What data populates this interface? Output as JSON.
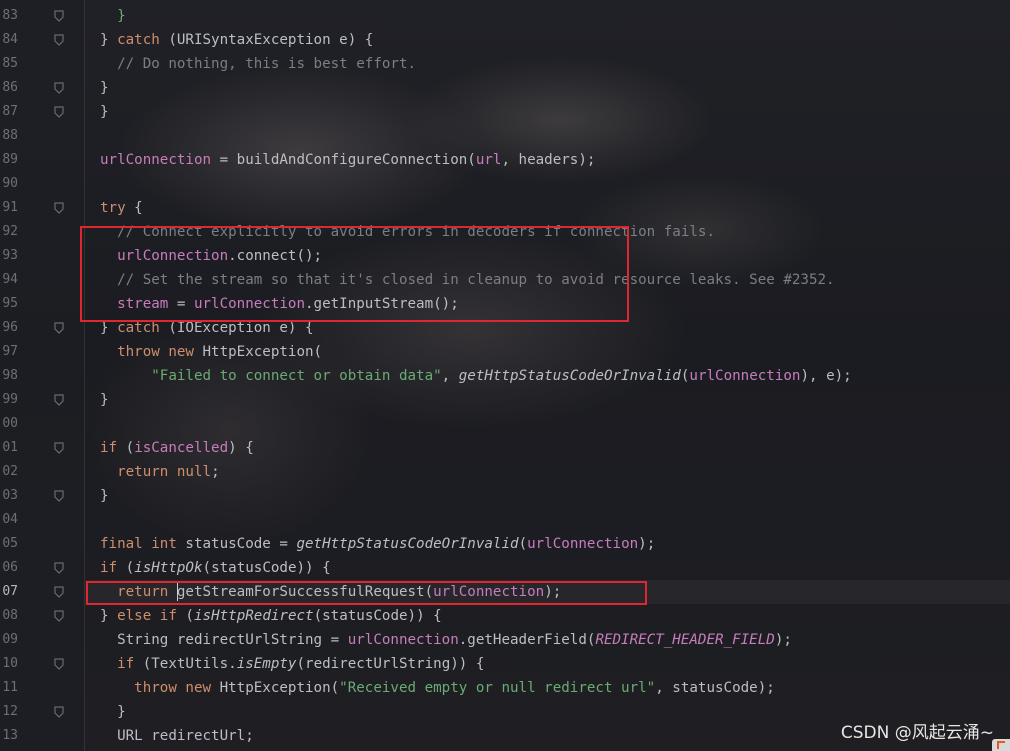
{
  "editor": {
    "gutter": {
      "line_numbers": [
        "83",
        "84",
        "85",
        "86",
        "87",
        "88",
        "89",
        "90",
        "91",
        "92",
        "93",
        "94",
        "95",
        "96",
        "97",
        "98",
        "99",
        "00",
        "01",
        "02",
        "03",
        "04",
        "05",
        "06",
        "07",
        "08",
        "09",
        "10",
        "11",
        "12",
        "13"
      ],
      "current_line": "07"
    },
    "lines": [
      [
        "  ",
        {
          "t": "}",
          "c": "str"
        }
      ],
      [
        {
          "t": "} "
        },
        {
          "t": "catch",
          "c": "kw"
        },
        {
          "t": " (URISyntaxException e) {"
        }
      ],
      [
        "  ",
        {
          "t": "// Do nothing, this is best effort.",
          "c": "cm"
        }
      ],
      [
        {
          "t": "}"
        }
      ],
      [
        "}"
      ],
      [
        ""
      ],
      [
        {
          "t": "urlConnection",
          "c": "fld"
        },
        {
          "t": " = buildAndConfigureConnection("
        },
        {
          "t": "url",
          "c": "fld"
        },
        {
          "t": ", headers);"
        }
      ],
      [
        ""
      ],
      [
        {
          "t": "try",
          "c": "kw"
        },
        {
          "t": " {"
        }
      ],
      [
        "  ",
        {
          "t": "// Connect explicitly to avoid errors in decoders if connection fails.",
          "c": "cm"
        }
      ],
      [
        "  ",
        {
          "t": "urlConnection",
          "c": "fld"
        },
        {
          "t": ".connect();"
        }
      ],
      [
        "  ",
        {
          "t": "// Set the stream so that it's closed in cleanup to avoid resource leaks. See #2352.",
          "c": "cm"
        }
      ],
      [
        "  ",
        {
          "t": "stream",
          "c": "fld"
        },
        {
          "t": " = "
        },
        {
          "t": "urlConnection",
          "c": "fld"
        },
        {
          "t": ".getInputStream();"
        }
      ],
      [
        {
          "t": "} "
        },
        {
          "t": "catch",
          "c": "kw"
        },
        {
          "t": " (IOException e) {"
        }
      ],
      [
        "  ",
        {
          "t": "throw new",
          "c": "kw"
        },
        {
          "t": " HttpException("
        }
      ],
      [
        "      ",
        {
          "t": "\"Failed to connect or obtain data\"",
          "c": "str"
        },
        {
          "t": ", "
        },
        {
          "t": "getHttpStatusCodeOrInvalid",
          "c": "ita"
        },
        {
          "t": "("
        },
        {
          "t": "urlConnection",
          "c": "fld"
        },
        {
          "t": "), e);"
        }
      ],
      [
        "}"
      ],
      [
        ""
      ],
      [
        {
          "t": "if",
          "c": "kw"
        },
        {
          "t": " ("
        },
        {
          "t": "isCancelled",
          "c": "fld"
        },
        {
          "t": ") {"
        }
      ],
      [
        "  ",
        {
          "t": "return null",
          "c": "kw"
        },
        {
          "t": ";"
        }
      ],
      [
        "}"
      ],
      [
        ""
      ],
      [
        {
          "t": "final int",
          "c": "kw"
        },
        {
          "t": " statusCode = "
        },
        {
          "t": "getHttpStatusCodeOrInvalid",
          "c": "ita"
        },
        {
          "t": "("
        },
        {
          "t": "urlConnection",
          "c": "fld"
        },
        {
          "t": ");"
        }
      ],
      [
        {
          "t": "if",
          "c": "kw"
        },
        {
          "t": " ("
        },
        {
          "t": "isHttpOk",
          "c": "ita"
        },
        {
          "t": "(statusCode)) {"
        }
      ],
      [
        "  ",
        {
          "t": "return",
          "c": "kw"
        },
        {
          "t": " getStreamForSuccessfulRequest("
        },
        {
          "t": "urlConnection",
          "c": "fld"
        },
        {
          "t": ");"
        }
      ],
      [
        {
          "t": "} "
        },
        {
          "t": "else if",
          "c": "kw"
        },
        {
          "t": " ("
        },
        {
          "t": "isHttpRedirect",
          "c": "ita"
        },
        {
          "t": "(statusCode)) {"
        }
      ],
      [
        "  ",
        {
          "t": "String redirectUrlString = "
        },
        {
          "t": "urlConnection",
          "c": "fld"
        },
        {
          "t": ".getHeaderField("
        },
        {
          "t": "REDIRECT_HEADER_FIELD",
          "c": "fld ita"
        },
        {
          "t": ");"
        }
      ],
      [
        "  ",
        {
          "t": "if",
          "c": "kw"
        },
        {
          "t": " (TextUtils."
        },
        {
          "t": "isEmpty",
          "c": "ita"
        },
        {
          "t": "(redirectUrlString)) {"
        }
      ],
      [
        "    ",
        {
          "t": "throw new",
          "c": "kw"
        },
        {
          "t": " HttpException("
        },
        {
          "t": "\"Received empty or null redirect url\"",
          "c": "str"
        },
        {
          "t": ", statusCode);"
        }
      ],
      [
        "  ",
        {
          "t": "}"
        }
      ],
      [
        "  ",
        {
          "t": "URL redirectUrl;"
        }
      ]
    ]
  },
  "watermark": {
    "text": "CSDN @风起云涌~"
  },
  "colors": {
    "highlight_box": "#e0262e",
    "keyword": "#cf8e6d",
    "comment": "#7a7e85",
    "field": "#c77dbb",
    "string": "#6aab73"
  }
}
